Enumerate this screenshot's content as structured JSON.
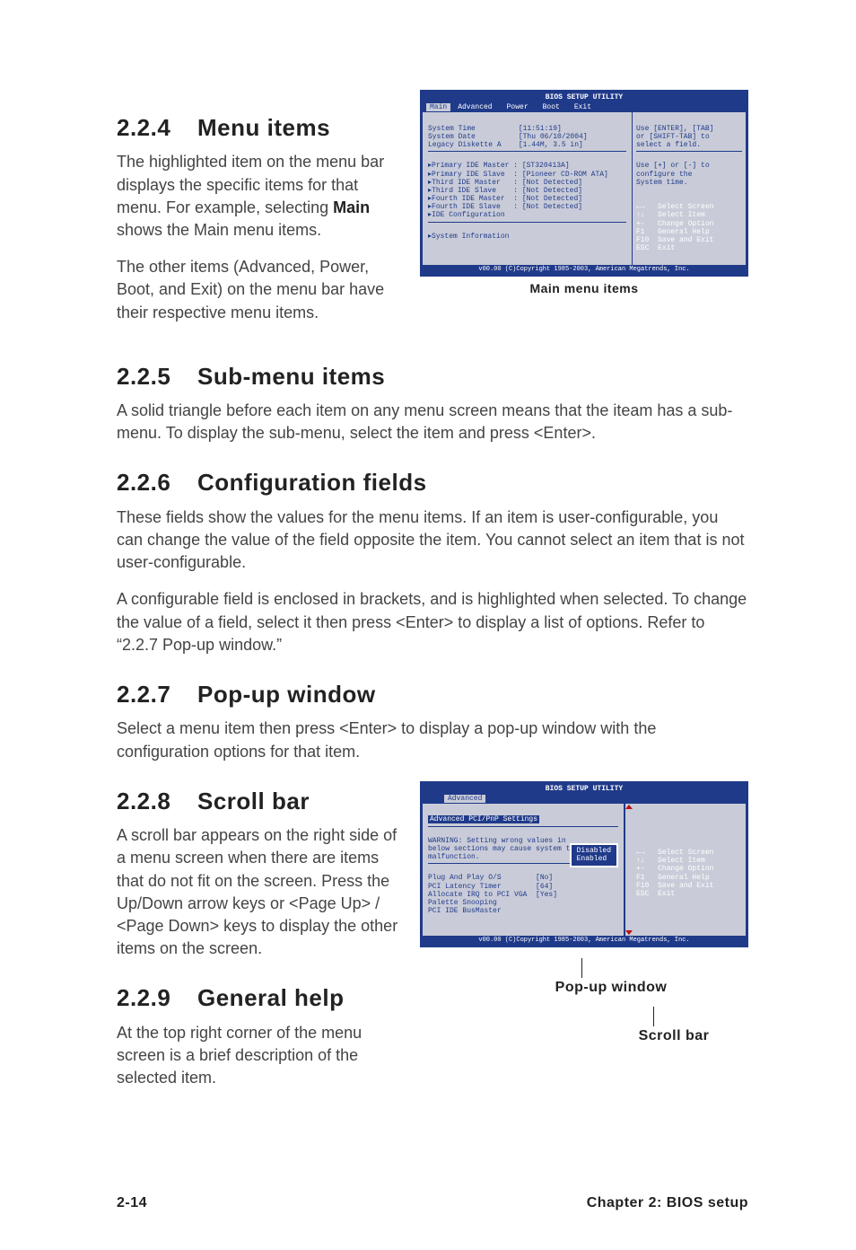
{
  "sections": {
    "s224": {
      "num": "2.2.4",
      "title": "Menu items",
      "p1": "The highlighted item on the menu bar  displays the specific items for that menu. For example, selecting ",
      "mainword": "Main",
      "p1b": " shows the Main menu items.",
      "p2": "The other items (Advanced, Power, Boot, and Exit) on the menu bar have their respective menu items."
    },
    "s225": {
      "num": "2.2.5",
      "title": "Sub-menu items",
      "p1": "A solid triangle before each item on any menu screen means that the iteam has a sub-menu. To display the sub-menu, select the item and press <Enter>."
    },
    "s226": {
      "num": "2.2.6",
      "title": "Configuration fields",
      "p1": "These fields show the values for the menu items. If an item is user-configurable, you can change the value of the field opposite the item. You cannot select an item that is not user-configurable.",
      "p2": "A configurable field is enclosed in brackets, and is highlighted when selected. To change the value of a field, select it then press <Enter> to display a list of options. Refer to “2.2.7 Pop-up window.”"
    },
    "s227": {
      "num": "2.2.7",
      "title": "Pop-up window",
      "p1": "Select a menu item then press <Enter> to display a pop-up window with the configuration options for that item."
    },
    "s228": {
      "num": "2.2.8",
      "title": "Scroll bar",
      "p1": "A scroll bar appears on the right side of a menu screen when there are items that do not fit on the screen. Press the",
      "p2": "Up/Down arrow keys or <Page Up> / <Page Down> keys to display the other items on the screen."
    },
    "s229": {
      "num": "2.2.9",
      "title": "General help",
      "p1": "At the top right corner of the menu screen is a brief description of the selected item."
    }
  },
  "bios1": {
    "title": "BIOS SETUP UTILITY",
    "tabs": [
      "Main",
      "Advanced",
      "Power",
      "Boot",
      "Exit"
    ],
    "active_tab": "Main",
    "rows": [
      "System Time          [11:51:19]",
      "System Date          [Thu 06/10/2004]",
      "Legacy Diskette A    [1.44M, 3.5 in]"
    ],
    "subrows": [
      "Primary IDE Master : [ST320413A]",
      "Primary IDE Slave  : [Pioneer CD-ROM ATA]",
      "Third IDE Master   : [Not Detected]",
      "Third IDE Slave    : [Not Detected]",
      "Fourth IDE Master  : [Not Detected]",
      "Fourth IDE Slave   : [Not Detected]",
      "IDE Configuration"
    ],
    "lastrow": "System Information",
    "help_top": "Use [ENTER], [TAB]\nor [SHIFT-TAB] to\nselect a field.",
    "help_mid": "Use [+] or [-] to\nconfigure the\nSystem time.",
    "nav": "←→   Select Screen\n↑↓   Select Item\n+-   Change Option\nF1   General Help\nF10  Save and Exit\nESC  Exit",
    "copyright": "v00.00 (C)Copyright 1985-2003, American Megatrends, Inc.",
    "caption": "Main menu items"
  },
  "bios2": {
    "title": "BIOS SETUP UTILITY",
    "active_tab": "Advanced",
    "heading": "Advanced PCI/PnP Settings",
    "warning": "WARNING: Setting wrong values in\nbelow sections may cause system to\nmalfunction.",
    "rows": [
      "Plug And Play O/S        [No]",
      "PCI Latency Timer        [64]",
      "Allocate IRQ to PCI VGA  [Yes]",
      "Palette Snooping         ",
      "PCI IDE BusMaster        "
    ],
    "popup": "Disabled\nEnabled",
    "nav": "←→   Select Screen\n↑↓   Select Item\n+-   Change Option\nF1   General Help\nF10  Save and Exit\nESC  Exit",
    "copyright": "v00.00 (C)Copyright 1985-2003, American Megatrends, Inc.",
    "label_popup": "Pop-up window",
    "label_scroll": "Scroll bar"
  },
  "footer": {
    "left": "2-14",
    "right": "Chapter 2: BIOS setup"
  }
}
